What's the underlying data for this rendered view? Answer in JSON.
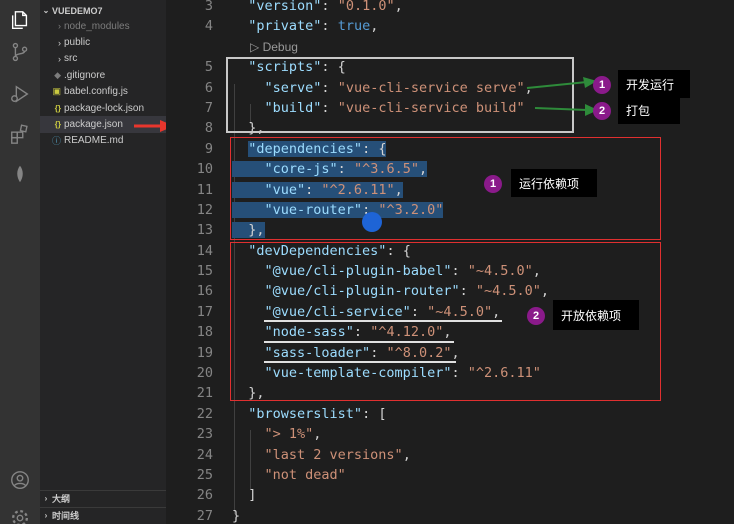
{
  "explorer": {
    "root": "VUEDEMO7",
    "items": [
      {
        "label": "node_modules",
        "kind": "folder",
        "dim": true
      },
      {
        "label": "public",
        "kind": "folder"
      },
      {
        "label": "src",
        "kind": "folder"
      },
      {
        "label": ".gitignore",
        "kind": "git"
      },
      {
        "label": "babel.config.js",
        "kind": "js"
      },
      {
        "label": "package-lock.json",
        "kind": "json"
      },
      {
        "label": "package.json",
        "kind": "json",
        "active": true
      },
      {
        "label": "README.md",
        "kind": "md"
      }
    ],
    "outline": "大纲",
    "timeline": "时间线"
  },
  "editor": {
    "line_numbers": [
      "3",
      "4",
      "",
      "5",
      "6",
      "7",
      "8",
      "9",
      "10",
      "11",
      "12",
      "13",
      "14",
      "15",
      "16",
      "17",
      "18",
      "19",
      "20",
      "21",
      "22",
      "23",
      "24",
      "25",
      "26",
      "27"
    ],
    "codelens": "▷ Debug"
  },
  "annotations": {
    "scripts_serve": {
      "num": "1",
      "label": "开发运行"
    },
    "scripts_build": {
      "num": "2",
      "label": "打包"
    },
    "deps": {
      "num": "1",
      "label": "运行依赖项"
    },
    "devdeps": {
      "num": "2",
      "label": "开放依赖项"
    }
  },
  "colors": {
    "accent_arrow": "#e8362d",
    "marker": "#8a1a8a",
    "green_arrow": "#2e8b3a"
  }
}
